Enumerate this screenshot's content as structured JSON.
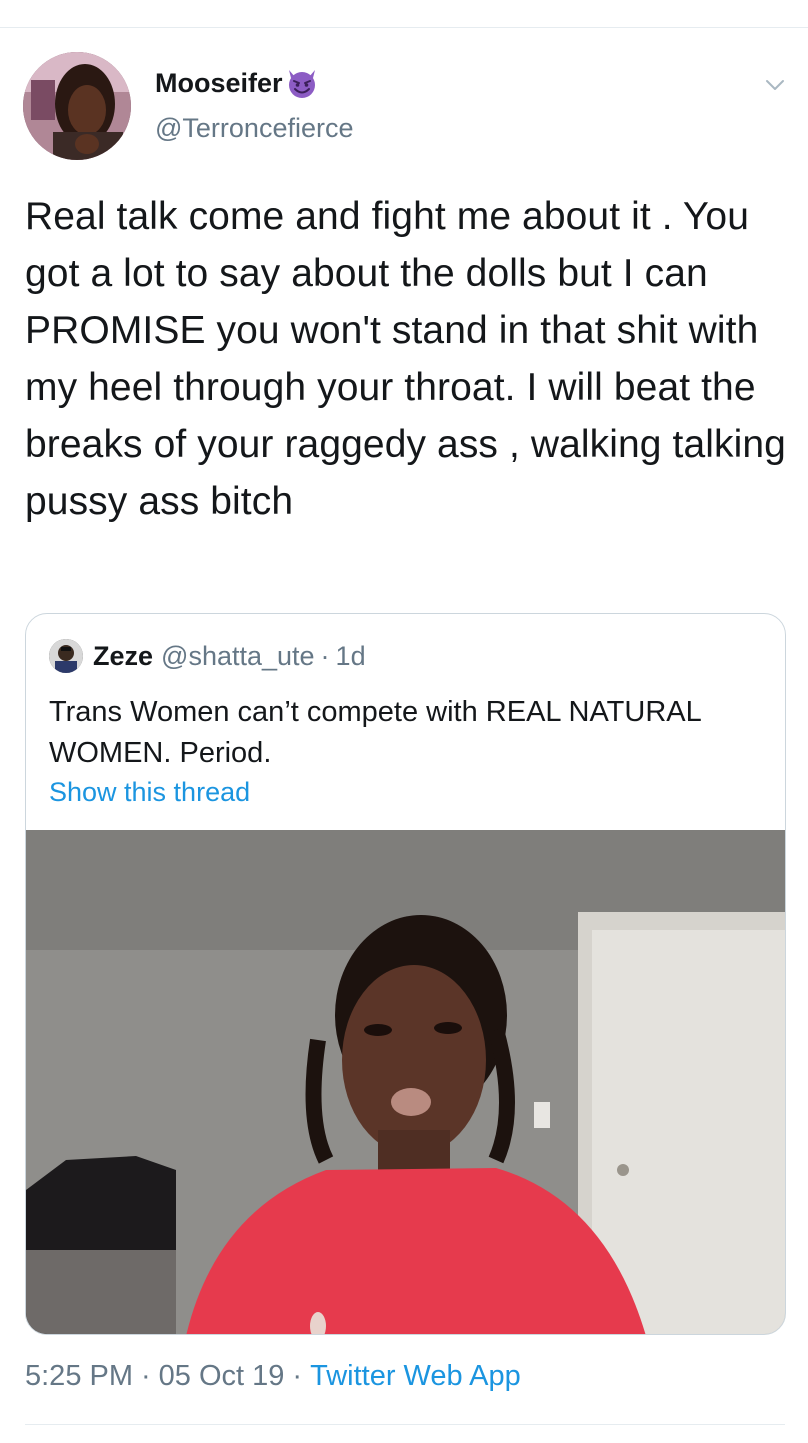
{
  "tweet": {
    "author": {
      "display_name": "Mooseifer",
      "handle": "@Terroncefierce",
      "name_emoji": "smiling-devil-icon"
    },
    "menu_icon": "chevron-down-icon",
    "text": "Real talk come and fight me about it . You got a lot to say about the dolls but I can PROMISE you won't stand in that shit with my heel through your throat. I will beat the breaks of your raggedy ass , walking talking pussy ass bitch",
    "time": "5:25 PM",
    "date": "05 Oct 19",
    "source": "Twitter Web App",
    "separator": "·"
  },
  "quoted": {
    "display_name": "Zeze",
    "handle": "@shatta_ute",
    "separator": "·",
    "age": "1d",
    "text": "Trans Women can’t compete with REAL NATURAL WOMEN. Period.",
    "show_thread_label": "Show this thread"
  },
  "colors": {
    "text": "#14171a",
    "secondary": "#657786",
    "link": "#1b95e0",
    "border": "#ccd6dd",
    "emoji": "#8c5cc4"
  }
}
